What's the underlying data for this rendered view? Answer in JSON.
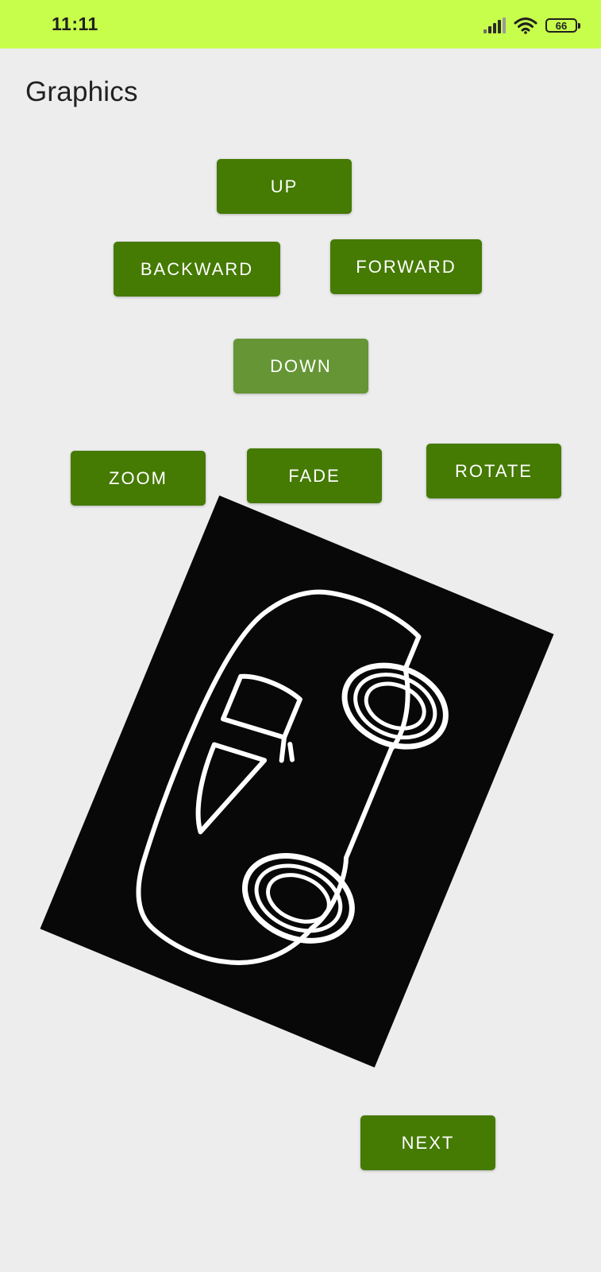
{
  "status_bar": {
    "time": "11:11",
    "battery_level": "66",
    "icons": [
      "signal-icon",
      "wifi-icon",
      "battery-icon"
    ],
    "background_color": "#c7fd4b"
  },
  "header": {
    "title": "Graphics"
  },
  "controls": {
    "up_label": "UP",
    "backward_label": "BACKWARD",
    "forward_label": "FORWARD",
    "down_label": "DOWN",
    "zoom_label": "ZOOM",
    "fade_label": "FADE",
    "rotate_label": "ROTATE",
    "next_label": "NEXT",
    "button_color": "#457a03",
    "disabled_button_color": "#659534"
  },
  "image": {
    "icon": "car-icon",
    "rotation_deg": 22.5
  }
}
